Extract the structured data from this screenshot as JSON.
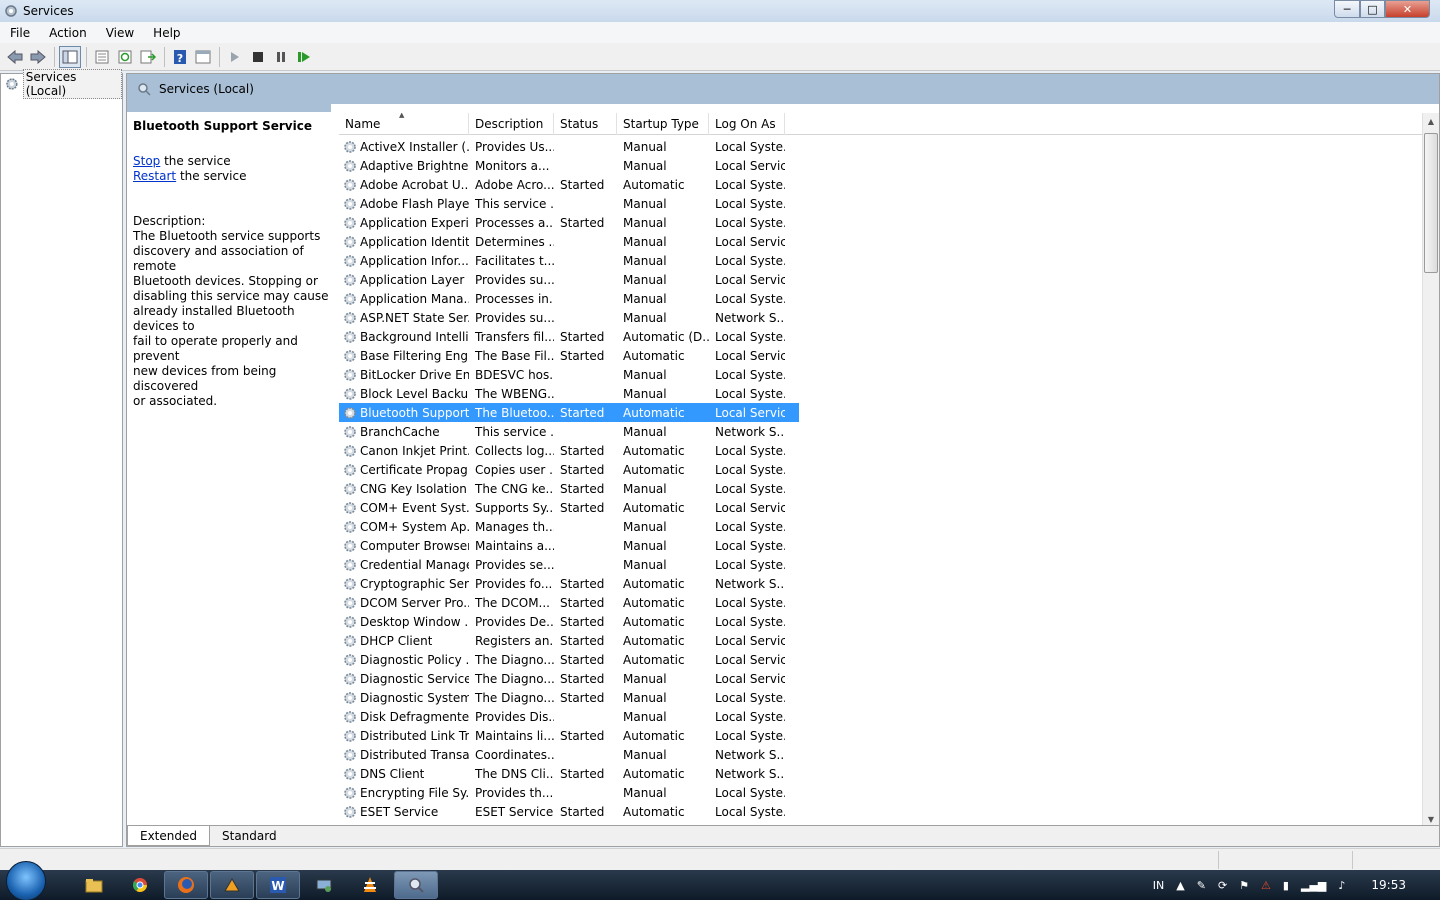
{
  "window": {
    "title": "Services",
    "controls": {
      "minimize": "─",
      "maximize": "□",
      "close": "✕"
    }
  },
  "menu": [
    "File",
    "Action",
    "View",
    "Help"
  ],
  "toolbar_icons": [
    "back-icon",
    "forward-icon",
    "console-tree-icon",
    "properties-icon",
    "refresh-icon",
    "export-list-icon",
    "help-icon",
    "view-icon",
    "start-service-icon",
    "stop-service-icon",
    "pause-service-icon",
    "restart-service-icon"
  ],
  "tree": {
    "item": "Services (Local)"
  },
  "main": {
    "header": "Services (Local)",
    "selected_service_title": "Bluetooth Support Service",
    "stop_link": "Stop",
    "stop_text": " the service",
    "restart_link": "Restart",
    "restart_text": " the service",
    "description_label": "Description:",
    "description_lines": [
      "The Bluetooth service supports",
      "discovery and association of remote",
      "Bluetooth devices.  Stopping or",
      "disabling this service may cause",
      "already installed Bluetooth devices to",
      "fail to operate properly and prevent",
      "new devices from being discovered",
      "or associated."
    ]
  },
  "columns": {
    "name": "Name",
    "description": "Description",
    "status": "Status",
    "startup_type": "Startup Type",
    "log_on_as": "Log On As",
    "sort_indicator": "▲"
  },
  "services": [
    {
      "name": "ActiveX Installer (...",
      "description": "Provides Us...",
      "status": "",
      "startup": "Manual",
      "logon": "Local Syste..."
    },
    {
      "name": "Adaptive Brightness",
      "description": "Monitors a...",
      "status": "",
      "startup": "Manual",
      "logon": "Local Service"
    },
    {
      "name": "Adobe Acrobat U...",
      "description": "Adobe Acro...",
      "status": "Started",
      "startup": "Automatic",
      "logon": "Local Syste..."
    },
    {
      "name": "Adobe Flash Playe...",
      "description": "This service ...",
      "status": "",
      "startup": "Manual",
      "logon": "Local Syste..."
    },
    {
      "name": "Application Experi...",
      "description": "Processes a...",
      "status": "Started",
      "startup": "Manual",
      "logon": "Local Syste..."
    },
    {
      "name": "Application Identity",
      "description": "Determines ...",
      "status": "",
      "startup": "Manual",
      "logon": "Local Service"
    },
    {
      "name": "Application Infor...",
      "description": "Facilitates t...",
      "status": "",
      "startup": "Manual",
      "logon": "Local Syste..."
    },
    {
      "name": "Application Layer ...",
      "description": "Provides su...",
      "status": "",
      "startup": "Manual",
      "logon": "Local Service"
    },
    {
      "name": "Application Mana...",
      "description": "Processes in...",
      "status": "",
      "startup": "Manual",
      "logon": "Local Syste..."
    },
    {
      "name": "ASP.NET State Ser...",
      "description": "Provides su...",
      "status": "",
      "startup": "Manual",
      "logon": "Network S..."
    },
    {
      "name": "Background Intelli...",
      "description": "Transfers fil...",
      "status": "Started",
      "startup": "Automatic (D...",
      "logon": "Local Syste..."
    },
    {
      "name": "Base Filtering Engi...",
      "description": "The Base Fil...",
      "status": "Started",
      "startup": "Automatic",
      "logon": "Local Service"
    },
    {
      "name": "BitLocker Drive En...",
      "description": "BDESVC hos...",
      "status": "",
      "startup": "Manual",
      "logon": "Local Syste..."
    },
    {
      "name": "Block Level Backu...",
      "description": "The WBENG...",
      "status": "",
      "startup": "Manual",
      "logon": "Local Syste..."
    },
    {
      "name": "Bluetooth Support...",
      "description": "The Bluetoo...",
      "status": "Started",
      "startup": "Automatic",
      "logon": "Local Service",
      "selected": true
    },
    {
      "name": "BranchCache",
      "description": "This service ...",
      "status": "",
      "startup": "Manual",
      "logon": "Network S..."
    },
    {
      "name": "Canon Inkjet Print...",
      "description": "Collects log...",
      "status": "Started",
      "startup": "Automatic",
      "logon": "Local Syste..."
    },
    {
      "name": "Certificate Propag...",
      "description": "Copies user ...",
      "status": "Started",
      "startup": "Automatic",
      "logon": "Local Syste..."
    },
    {
      "name": "CNG Key Isolation",
      "description": "The CNG ke...",
      "status": "Started",
      "startup": "Manual",
      "logon": "Local Syste..."
    },
    {
      "name": "COM+ Event Syst...",
      "description": "Supports Sy...",
      "status": "Started",
      "startup": "Automatic",
      "logon": "Local Service"
    },
    {
      "name": "COM+ System Ap...",
      "description": "Manages th...",
      "status": "",
      "startup": "Manual",
      "logon": "Local Syste..."
    },
    {
      "name": "Computer Browser",
      "description": "Maintains a...",
      "status": "",
      "startup": "Manual",
      "logon": "Local Syste..."
    },
    {
      "name": "Credential Manager",
      "description": "Provides se...",
      "status": "",
      "startup": "Manual",
      "logon": "Local Syste..."
    },
    {
      "name": "Cryptographic Ser...",
      "description": "Provides fo...",
      "status": "Started",
      "startup": "Automatic",
      "logon": "Network S..."
    },
    {
      "name": "DCOM Server Pro...",
      "description": "The DCOM...",
      "status": "Started",
      "startup": "Automatic",
      "logon": "Local Syste..."
    },
    {
      "name": "Desktop Window ...",
      "description": "Provides De...",
      "status": "Started",
      "startup": "Automatic",
      "logon": "Local Syste..."
    },
    {
      "name": "DHCP Client",
      "description": "Registers an...",
      "status": "Started",
      "startup": "Automatic",
      "logon": "Local Service"
    },
    {
      "name": "Diagnostic Policy ...",
      "description": "The Diagno...",
      "status": "Started",
      "startup": "Automatic",
      "logon": "Local Service"
    },
    {
      "name": "Diagnostic Service...",
      "description": "The Diagno...",
      "status": "Started",
      "startup": "Manual",
      "logon": "Local Service"
    },
    {
      "name": "Diagnostic System...",
      "description": "The Diagno...",
      "status": "Started",
      "startup": "Manual",
      "logon": "Local Syste..."
    },
    {
      "name": "Disk Defragmenter",
      "description": "Provides Dis...",
      "status": "",
      "startup": "Manual",
      "logon": "Local Syste..."
    },
    {
      "name": "Distributed Link Tr...",
      "description": "Maintains li...",
      "status": "Started",
      "startup": "Automatic",
      "logon": "Local Syste..."
    },
    {
      "name": "Distributed Transa...",
      "description": "Coordinates...",
      "status": "",
      "startup": "Manual",
      "logon": "Network S..."
    },
    {
      "name": "DNS Client",
      "description": "The DNS Cli...",
      "status": "Started",
      "startup": "Automatic",
      "logon": "Network S..."
    },
    {
      "name": "Encrypting File Sy...",
      "description": "Provides th...",
      "status": "",
      "startup": "Manual",
      "logon": "Local Syste..."
    },
    {
      "name": "ESET Service",
      "description": "ESET Service",
      "status": "Started",
      "startup": "Automatic",
      "logon": "Local Syste..."
    }
  ],
  "view_tabs": [
    "Extended",
    "Standard"
  ],
  "taskbar": {
    "apps": [
      "explorer-icon",
      "chrome-icon",
      "firefox-icon",
      "winamp-icon",
      "word-icon",
      "network-icon",
      "vlc-icon",
      "services-icon"
    ],
    "tray_lang": "IN",
    "tray_icons": [
      "show-hidden-icon",
      "pen-icon",
      "sync-icon",
      "flag-icon",
      "warning-icon",
      "power-icon",
      "signal-icon",
      "volume-icon"
    ],
    "clock": "19:53"
  },
  "colors": {
    "selection": "#3399ff",
    "header_band": "#a9bfd6",
    "link": "#0033cc"
  }
}
